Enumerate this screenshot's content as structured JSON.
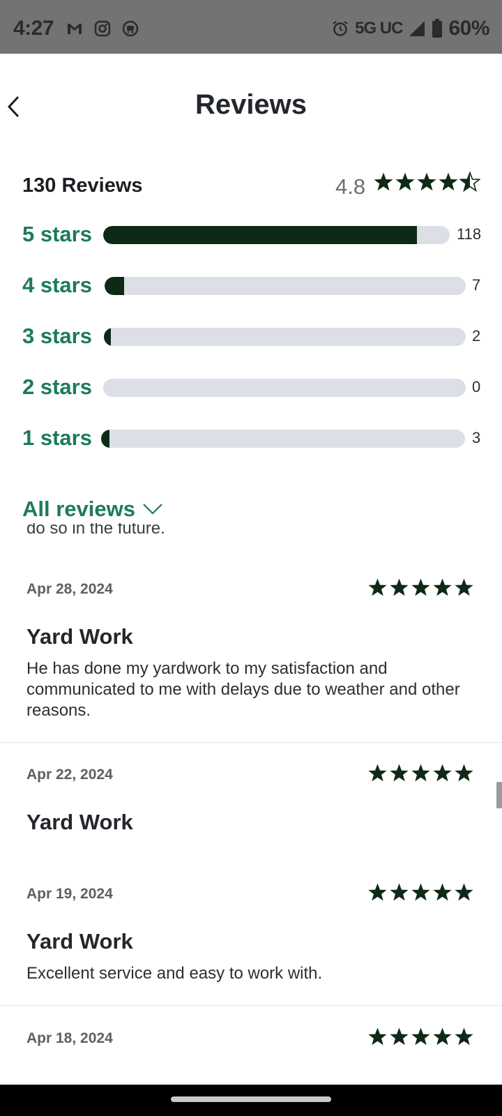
{
  "status_bar": {
    "time": "4:27",
    "left_icons": [
      "gmail-icon",
      "instagram-icon",
      "app-icon"
    ],
    "network": "5G UC",
    "battery": "60%"
  },
  "header": {
    "title": "Reviews",
    "back_icon": "chevron-left-icon"
  },
  "summary": {
    "count_label": "130 Reviews",
    "average": "4.8",
    "average_stars_filled": 4.5,
    "star_color": "#0e2a17"
  },
  "distribution": [
    {
      "label": "5 stars",
      "count": "118",
      "fill": 0.906
    },
    {
      "label": "4 stars",
      "count": "7",
      "fill": 0.054
    },
    {
      "label": "3 stars",
      "count": "2",
      "fill": 0.015
    },
    {
      "label": "2 stars",
      "count": "0",
      "fill": 0
    },
    {
      "label": "1 stars",
      "count": "3",
      "fill": 0.023
    }
  ],
  "filter": {
    "label": "All reviews"
  },
  "reviews": {
    "cut_text": "do so in the future.",
    "items": [
      {
        "date": "Apr 28, 2024",
        "rating": 5,
        "title": "Yard Work",
        "body": "He has done my yardwork to my satisfaction and communicated to me with delays due to weather and other reasons."
      },
      {
        "date": "Apr 22, 2024",
        "rating": 5,
        "title": "Yard Work",
        "body": ""
      },
      {
        "date": "Apr 19, 2024",
        "rating": 5,
        "title": "Yard Work",
        "body": "Excellent service and easy to work with."
      },
      {
        "date": "Apr 18, 2024",
        "rating": 5,
        "title": "",
        "body": ""
      }
    ]
  },
  "colors": {
    "accent": "#1e7a5c",
    "bar_fill": "#0e2a17",
    "bar_track": "#dcdfe5"
  }
}
